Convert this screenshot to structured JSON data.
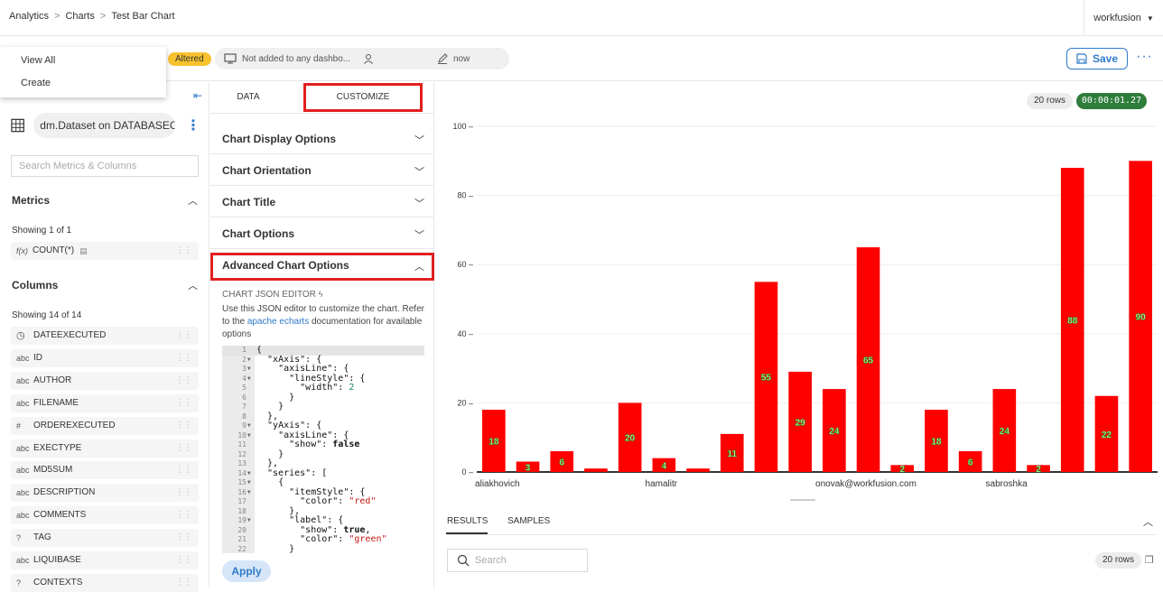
{
  "breadcrumb": [
    "Analytics",
    "Charts",
    "Test Bar Chart"
  ],
  "user_menu": "workfusion",
  "dropdown": [
    "View All",
    "Create"
  ],
  "header": {
    "altered": "Altered",
    "dashboards": "Not added to any dashbo...",
    "modified": "now",
    "save": "Save"
  },
  "left": {
    "dataset": "dm.Dataset on DATABASEC...",
    "search_placeholder": "Search Metrics & Columns",
    "metrics_title": "Metrics",
    "metrics_showing": "Showing 1 of 1",
    "metrics": [
      {
        "type": "f(x)",
        "name": "COUNT(*)"
      }
    ],
    "columns_title": "Columns",
    "columns_showing": "Showing 14 of 14",
    "columns": [
      {
        "type": "clock",
        "name": "DATEEXECUTED"
      },
      {
        "type": "abc",
        "name": "ID"
      },
      {
        "type": "abc",
        "name": "AUTHOR"
      },
      {
        "type": "abc",
        "name": "FILENAME"
      },
      {
        "type": "#",
        "name": "ORDEREXECUTED"
      },
      {
        "type": "abc",
        "name": "EXECTYPE"
      },
      {
        "type": "abc",
        "name": "MD5SUM"
      },
      {
        "type": "abc",
        "name": "DESCRIPTION"
      },
      {
        "type": "abc",
        "name": "COMMENTS"
      },
      {
        "type": "?",
        "name": "TAG"
      },
      {
        "type": "abc",
        "name": "LIQUIBASE"
      },
      {
        "type": "?",
        "name": "CONTEXTS"
      }
    ]
  },
  "middle": {
    "tabs": [
      "DATA",
      "CUSTOMIZE"
    ],
    "sections": [
      "Chart Display Options",
      "Chart Orientation",
      "Chart Title",
      "Chart Options",
      "Advanced Chart Options"
    ],
    "editor_label": "CHART JSON EDITOR",
    "editor_desc_1": "Use this JSON editor to customize the chart. Refer to the ",
    "editor_link": "apache echarts",
    "editor_desc_2": " documentation for available options",
    "apply": "Apply",
    "code_lines": [
      "{",
      "  \"xAxis\": {",
      "    \"axisLine\": {",
      "      \"lineStyle\": {",
      "        \"width\": 2",
      "      }",
      "    }",
      "  },",
      "  \"yAxis\": {",
      "    \"axisLine\": {",
      "      \"show\": false",
      "    }",
      "  },",
      "  \"series\": [",
      "    {",
      "      \"itemStyle\": {",
      "        \"color\": \"red\"",
      "      },",
      "      \"label\": {",
      "        \"show\": true,",
      "        \"color\": \"green\"",
      "      }"
    ],
    "folds": [
      2,
      3,
      4,
      9,
      10,
      14,
      15,
      16,
      19
    ]
  },
  "chart_meta": {
    "rows": "20 rows",
    "timer": "00:00:01.27"
  },
  "chart_data": {
    "type": "bar",
    "categories": [
      "aliakhovich",
      "",
      "",
      "",
      "",
      "hamalitr",
      "",
      "",
      "",
      "",
      "onovak@workfusion.com",
      "",
      "",
      "",
      "",
      "sabroshka",
      "",
      "",
      "",
      ""
    ],
    "values": [
      18,
      3,
      6,
      1,
      20,
      4,
      1,
      11,
      55,
      29,
      24,
      65,
      2,
      18,
      6,
      24,
      2,
      88,
      22,
      90
    ],
    "labels": [
      "18",
      "3",
      "6",
      "",
      "20",
      "4",
      "",
      "11",
      "55",
      "29",
      "24",
      "65",
      "2",
      "18",
      "6",
      "24",
      "2",
      "88",
      "22",
      "90"
    ],
    "bar_color": "#ff0000",
    "label_color": "#00a000",
    "ylim": [
      0,
      100
    ],
    "yticks": [
      0,
      20,
      40,
      60,
      80,
      100
    ],
    "grid": true
  },
  "results": {
    "tabs": [
      "RESULTS",
      "SAMPLES"
    ],
    "search_placeholder": "Search",
    "rows": "20 rows"
  },
  "colors": {
    "accent": "#2f7ac9",
    "highlight": "#e02020",
    "badge_yellow": "#f7c22e",
    "timer_green": "#2e7d3a"
  }
}
